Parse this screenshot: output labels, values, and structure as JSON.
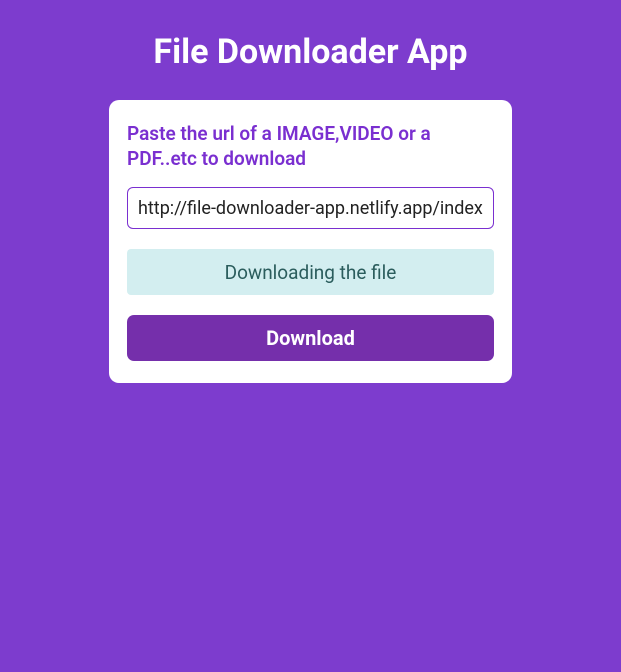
{
  "header": {
    "title": "File Downloader App"
  },
  "card": {
    "instruction": "Paste the url of a IMAGE,VIDEO or a PDF..etc to download",
    "url_input": {
      "value": "http://file-downloader-app.netlify.app/index"
    },
    "status_message": "Downloading the file",
    "download_button_label": "Download"
  },
  "colors": {
    "background": "#7d3cce",
    "card_bg": "#ffffff",
    "accent": "#7a2fd0",
    "status_bg": "#d3eef0",
    "button_bg": "#752fab"
  }
}
